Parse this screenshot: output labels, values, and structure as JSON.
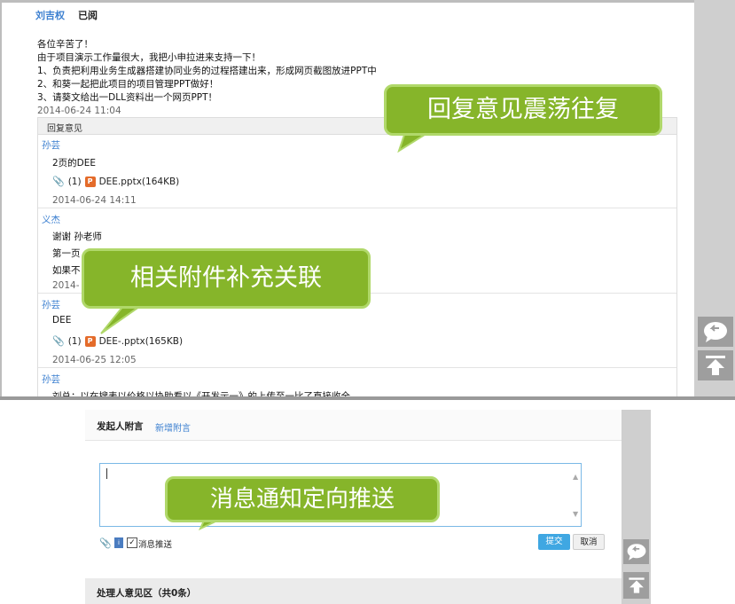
{
  "top": {
    "author": "刘吉权",
    "read_status": "已阅",
    "message_lines": [
      "各位辛苦了！",
      "由于项目演示工作量很大，我把小申拉进来支持一下！",
      "1、负责把利用业务生成器搭建协同业务的过程搭建出来，形成网页截图放进PPT中",
      "2、和葵一起把此项目的项目管理PPT做好！",
      "3、请葵文给出一DLL资料出一个网页PPT！"
    ],
    "message_date": "2014-06-24 11:04",
    "reply_header": "回复意见",
    "replies": [
      {
        "name": "孙芸",
        "lines": [
          "2页的DEE"
        ],
        "attach_count": "(1)",
        "attach_name": "DEE.pptx(164KB)",
        "date": "2014-06-24 14:11"
      },
      {
        "name": "义杰",
        "lines": [
          "谢谢 孙老师",
          "第一页",
          "如果不"
        ],
        "date": "2014-"
      },
      {
        "name": "孙芸",
        "lines": [
          "DEE"
        ],
        "attach_count": "(1)",
        "attach_name": "DEE-.pptx(165KB)",
        "date": "2014-06-25 12:05"
      },
      {
        "name": "孙芸",
        "lines": [
          "刘总：以在搜表以价格以协助看以《开发示一》的上传至一比了直接收全"
        ]
      }
    ]
  },
  "callouts": {
    "reply": "回复意见震荡往复",
    "attachment": "相关附件补充关联",
    "notify": "消息通知定向推送"
  },
  "bottom": {
    "title": "发起人附言",
    "add_link": "新增附言",
    "checkbox_label": "消息推送",
    "submit": "提交",
    "cancel": "取消",
    "section_title": "处理人意见区（共0条）"
  }
}
